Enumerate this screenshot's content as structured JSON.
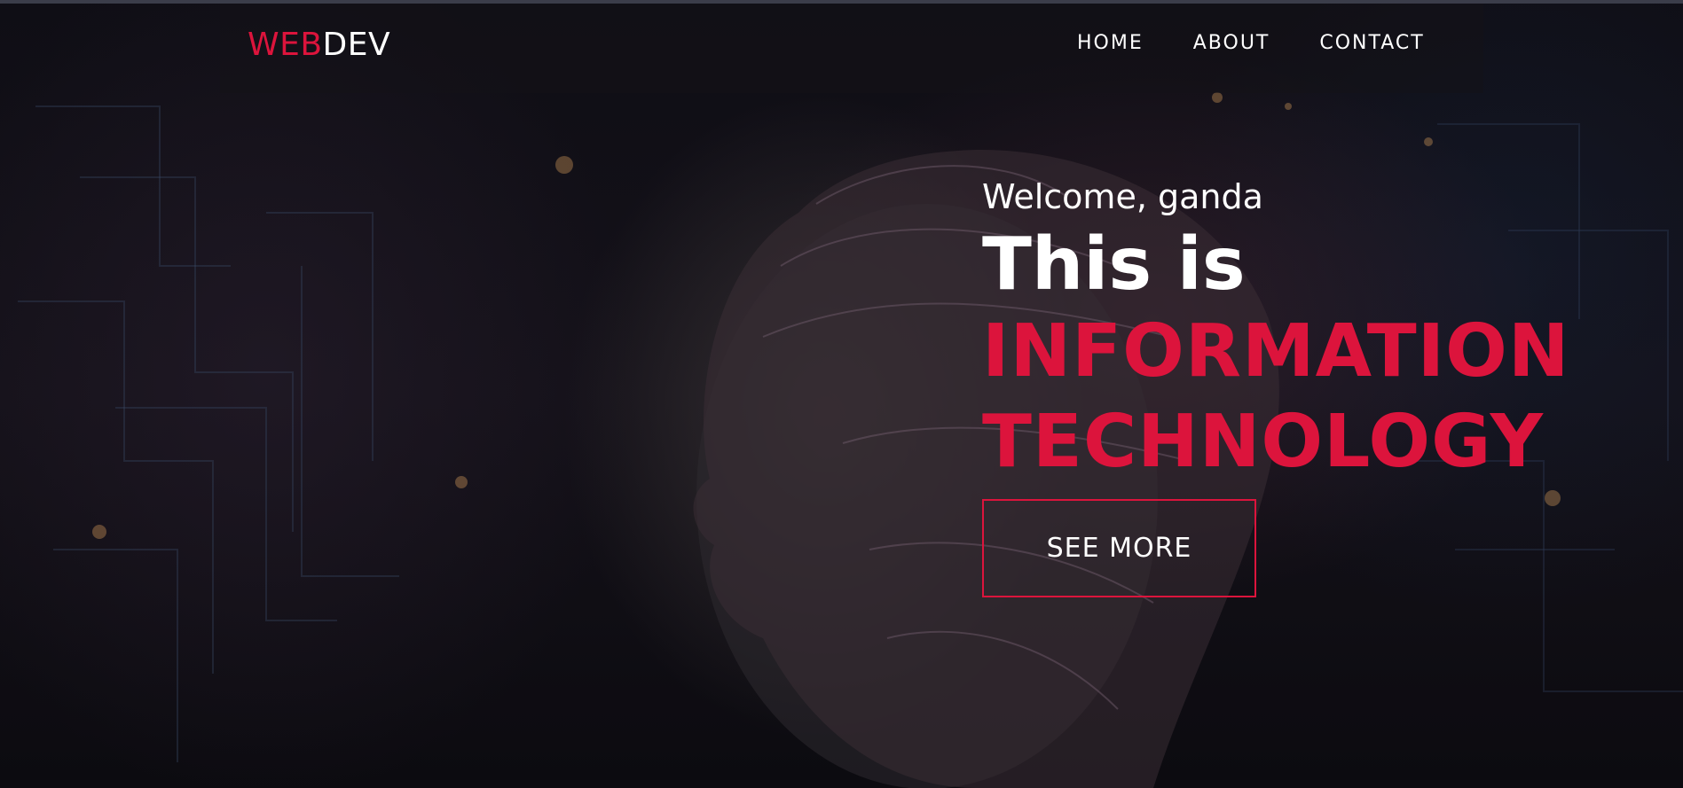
{
  "logo": {
    "part1": "WEB",
    "part2": "DEV"
  },
  "nav": {
    "items": [
      "HOME",
      "ABOUT",
      "CONTACT"
    ]
  },
  "hero": {
    "welcome": "Welcome, ganda",
    "line1": "This is",
    "line2": "INFORMATION",
    "line3": "TECHNOLOGY",
    "button_label": "SEE MORE"
  },
  "colors": {
    "accent": "#dc143c",
    "background": "#0d0c12",
    "text": "#ffffff"
  }
}
